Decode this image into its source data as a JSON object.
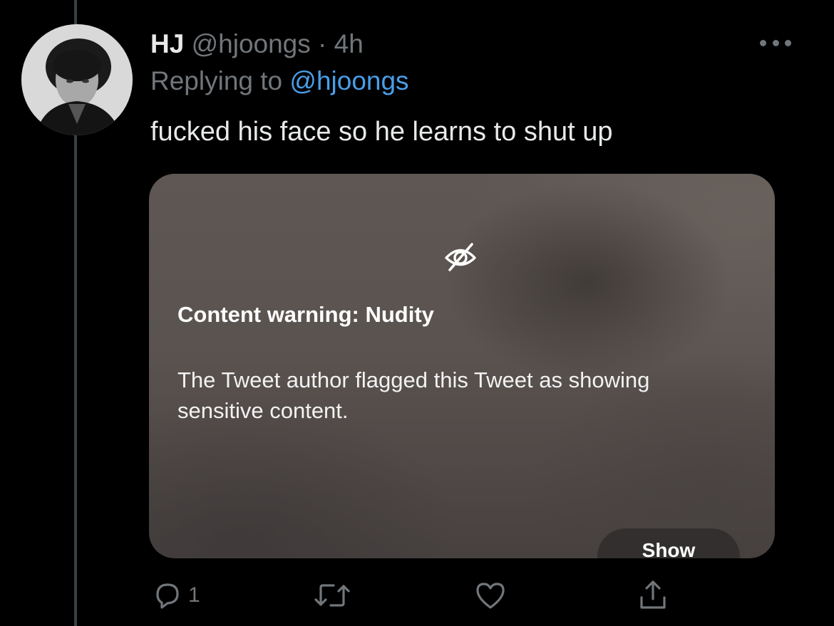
{
  "tweet": {
    "name": "HJ",
    "handle": "@hjoongs",
    "separator": "·",
    "time": "4h",
    "replying_prefix": "Replying to",
    "replying_to": "@hjoongs",
    "text": "fucked his face so he learns to shut up"
  },
  "media": {
    "warning_icon": "eye-slash-icon",
    "warning_title": "Content warning: Nudity",
    "warning_body": "The Tweet author flagged this Tweet as showing sensitive content.",
    "show_label": "Show"
  },
  "actions": {
    "reply_icon": "reply-icon",
    "reply_count": "1",
    "retweet_icon": "retweet-icon",
    "like_icon": "heart-icon",
    "share_icon": "share-icon"
  },
  "colors": {
    "background": "#000000",
    "text_primary": "#e7e9ea",
    "text_secondary": "#71767b",
    "link": "#4a9ee8",
    "thread_line": "#3a3f44"
  }
}
